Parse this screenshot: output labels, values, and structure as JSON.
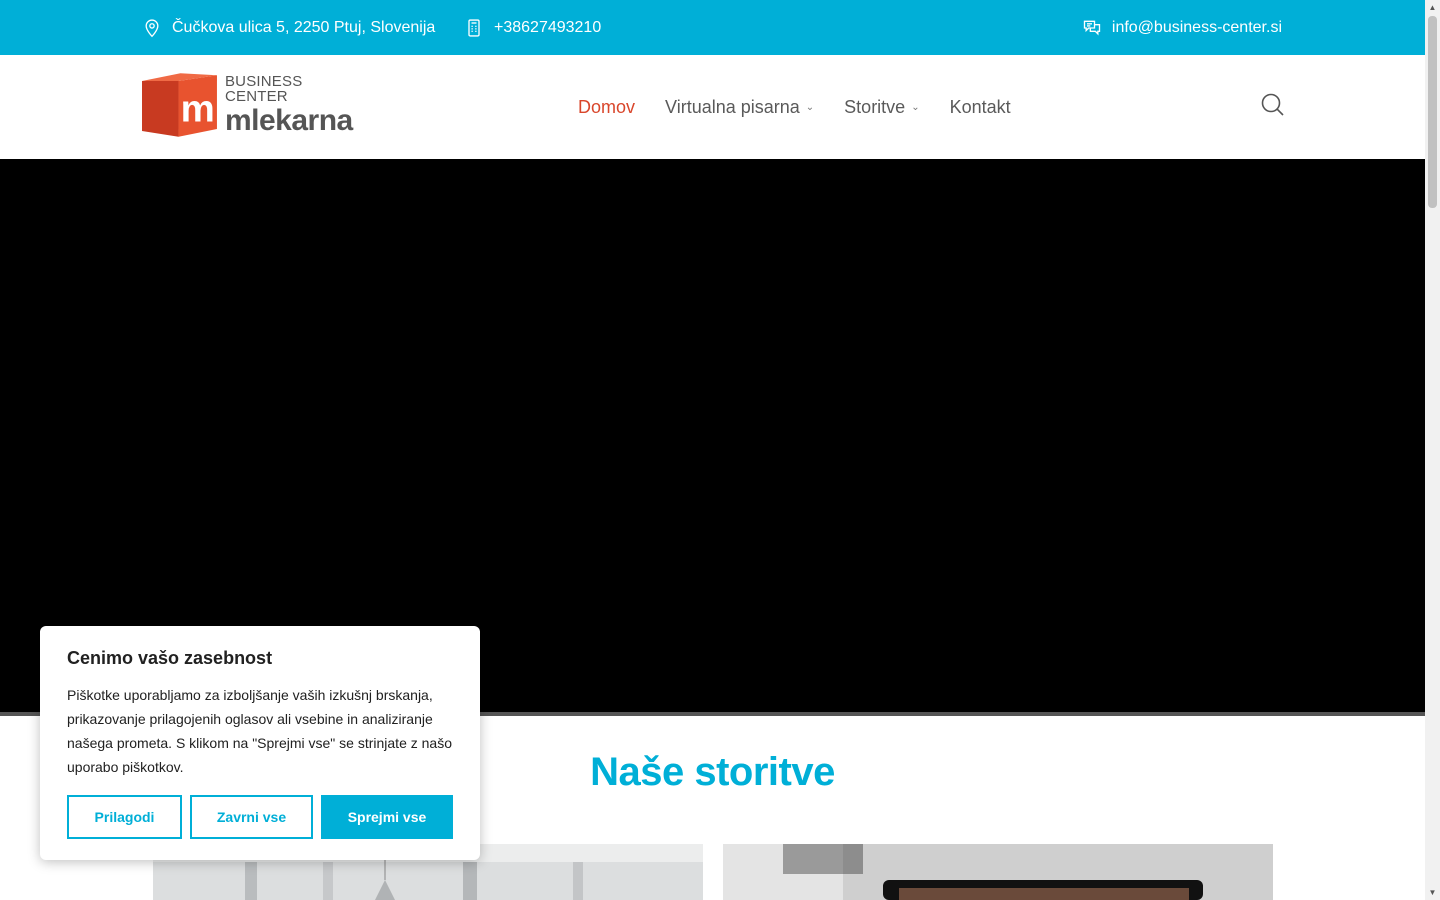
{
  "topbar": {
    "address": "Čučkova ulica 5, 2250 Ptuj, Slovenija",
    "phone": "+38627493210",
    "email": "info@business-center.si",
    "bg_color": "#00afd7"
  },
  "logo": {
    "top_text": "BUSINESS CENTER",
    "main_text": "mlekarna",
    "cube_letter": "m",
    "brand_color": "#d9462b"
  },
  "nav": {
    "items": [
      {
        "label": "Domov",
        "active": true
      },
      {
        "label": "Virtualna pisarna",
        "has_dropdown": true
      },
      {
        "label": "Storitve",
        "has_dropdown": true
      },
      {
        "label": "Kontakt"
      }
    ],
    "active_color": "#d9462b"
  },
  "section": {
    "title": "Naše storitve",
    "title_color": "#00afd7"
  },
  "cookie": {
    "title": "Cenimo vašo zasebnost",
    "text": "Piškotke uporabljamo za izboljšanje vaših izkušnj brskanja, prikazovanje prilagojenih oglasov ali vsebine in analiziranje našega prometa. S klikom na \"Sprejmi vse\" se strinjate z našo uporabo piškotkov.",
    "buttons": {
      "customize": "Prilagodi",
      "reject": "Zavrni vse",
      "accept": "Sprejmi vse"
    }
  },
  "icons": {
    "address": "map-pin-icon",
    "phone": "phone-icon",
    "email": "chat-icon",
    "search": "search-icon"
  }
}
